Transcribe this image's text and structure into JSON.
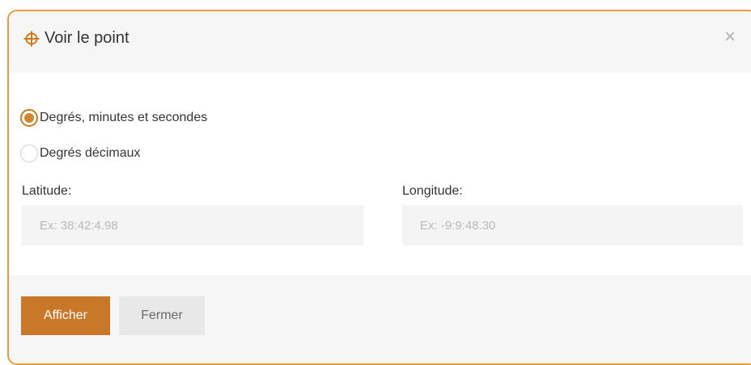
{
  "dialog": {
    "title": "Voir le point",
    "close_symbol": "×",
    "icon": "crosshair-icon",
    "accent_color": "#c9782a",
    "border_color": "#ec9a3a"
  },
  "format_options": [
    {
      "label": "Degrés, minutes et secondes",
      "checked": true
    },
    {
      "label": "Degrés décimaux",
      "checked": false
    }
  ],
  "latitude": {
    "label": "Latitude:",
    "value": "",
    "placeholder": "Ex: 38:42:4.98"
  },
  "longitude": {
    "label": "Longitude:",
    "value": "",
    "placeholder": "Ex: -9:9:48.30"
  },
  "footer": {
    "show_label": "Afficher",
    "close_label": "Fermer"
  }
}
